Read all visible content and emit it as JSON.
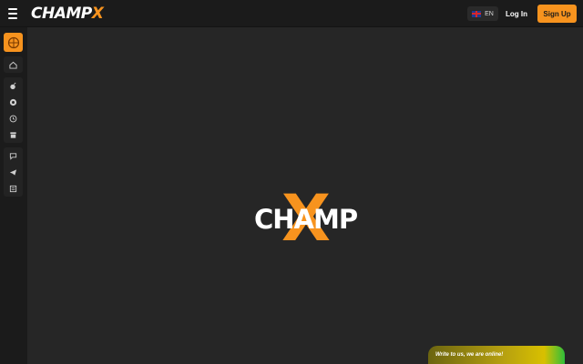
{
  "header": {
    "logo_text_main": "CHAMP",
    "logo_text_accent": "X",
    "language": {
      "code": "EN",
      "flag": "uk-flag-icon"
    },
    "login_label": "Log In",
    "signup_label": "Sign Up"
  },
  "sidebar": {
    "avatar_icon": "basketball-icon",
    "group1": [
      {
        "icon": "home-icon"
      }
    ],
    "group2": [
      {
        "icon": "bomb-icon"
      },
      {
        "icon": "chip-icon"
      },
      {
        "icon": "history-icon"
      },
      {
        "icon": "shop-icon"
      }
    ],
    "group3": [
      {
        "icon": "chat-icon"
      },
      {
        "icon": "telegram-icon"
      },
      {
        "icon": "news-icon"
      }
    ]
  },
  "main": {
    "center_logo_word": "CHAMP",
    "center_logo_accent": "X"
  },
  "chat_widget": {
    "label": "Write to us, we are online!"
  },
  "colors": {
    "accent": "#f7931e",
    "background": "#262626",
    "topbar": "#1b1b1b"
  }
}
